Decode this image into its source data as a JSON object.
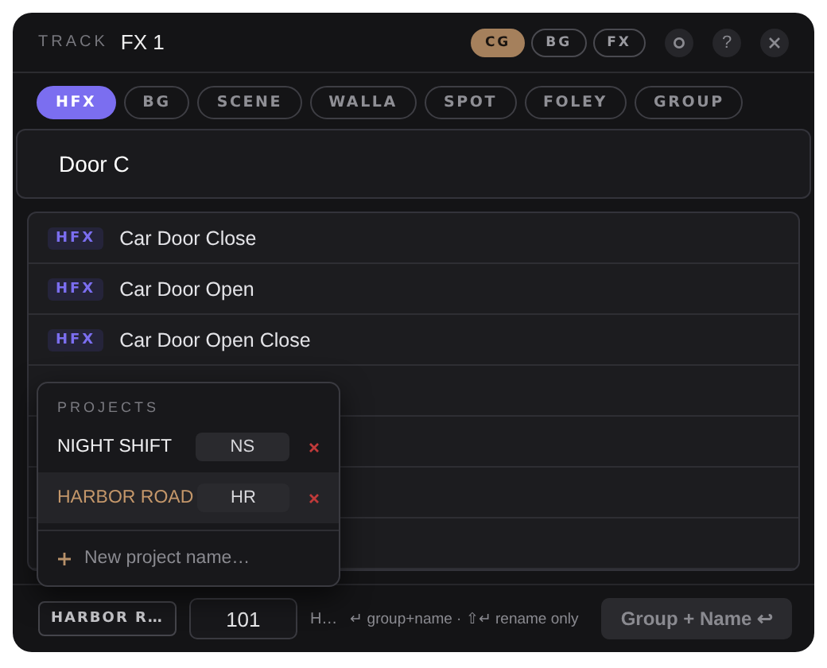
{
  "header": {
    "label": "TRACK",
    "track": "FX 1",
    "modes": [
      {
        "label": "CG",
        "selected": true
      },
      {
        "label": "BG",
        "selected": false
      },
      {
        "label": "FX",
        "selected": false
      }
    ],
    "help": "?"
  },
  "categories": [
    {
      "label": "HFX",
      "selected": true
    },
    {
      "label": "BG",
      "selected": false
    },
    {
      "label": "SCENE",
      "selected": false
    },
    {
      "label": "WALLA",
      "selected": false
    },
    {
      "label": "SPOT",
      "selected": false
    },
    {
      "label": "FOLEY",
      "selected": false
    },
    {
      "label": "GROUP",
      "selected": false
    }
  ],
  "name_field": {
    "value": "Door C"
  },
  "results": [
    {
      "tag": "HFX",
      "name": "Car Door Close"
    },
    {
      "tag": "HFX",
      "name": "Car Door Open"
    },
    {
      "tag": "HFX",
      "name": "Car Door Open Close"
    }
  ],
  "projects_popup": {
    "title": "PROJECTS",
    "items": [
      {
        "name": "NIGHT SHIFT",
        "code": "NS",
        "selected": false
      },
      {
        "name": "HARBOR ROAD",
        "code": "HR",
        "selected": true
      }
    ],
    "new_placeholder": "New project name…"
  },
  "footer": {
    "project": "HARBOR R…",
    "number": "101",
    "prefix": "H…",
    "hint": "↵ group+name · ⇧↵ rename only",
    "action": "Group + Name ↩"
  }
}
